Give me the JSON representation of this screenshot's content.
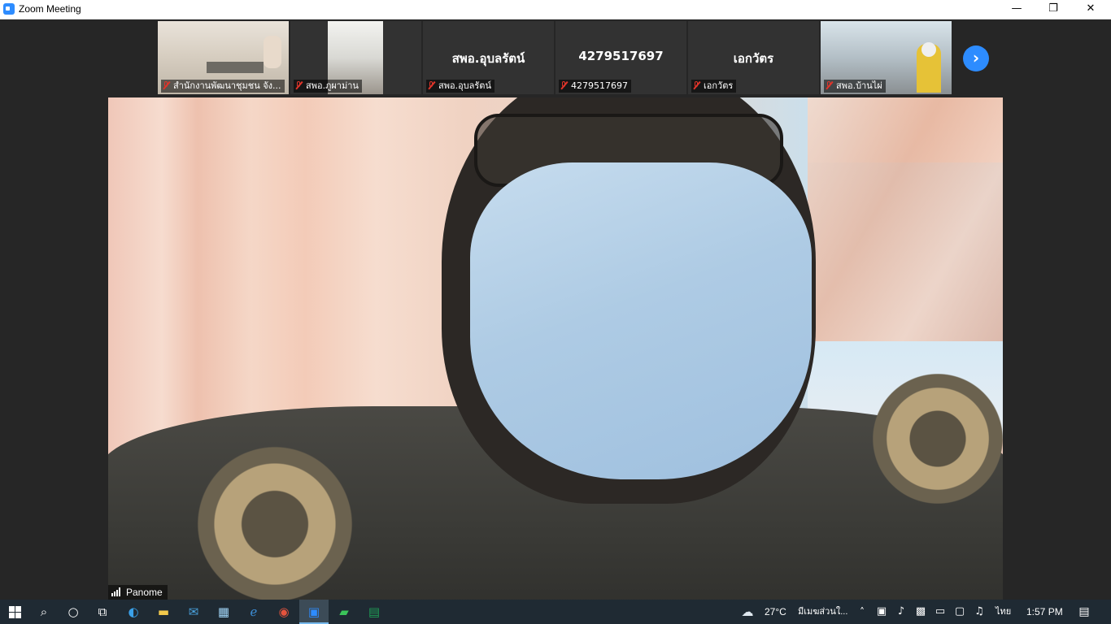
{
  "window": {
    "title": "Zoom Meeting",
    "minimize_glyph": "—",
    "maximize_glyph": "❐",
    "close_glyph": "✕"
  },
  "gallery": {
    "tiles": [
      {
        "label": "สำนักงานพัฒนาชุมชน จัง...",
        "muted": true,
        "has_video": true
      },
      {
        "label": "สพอ.ภูผาม่าน",
        "muted": true,
        "has_video": true
      },
      {
        "display_name": "สพอ.อุบลรัตน์",
        "label": "สพอ.อุบลรัตน์",
        "muted": true,
        "has_video": false
      },
      {
        "display_name": "4279517697",
        "label": "4279517697",
        "muted": true,
        "has_video": false
      },
      {
        "display_name": "เอกวัตร",
        "label": "เอกวัตร",
        "muted": true,
        "has_video": false
      },
      {
        "label": "สพอ.บ้านไผ่",
        "muted": true,
        "has_video": true
      }
    ],
    "next_glyph": "›"
  },
  "speaker": {
    "name": "Panome"
  },
  "taskbar": {
    "weather_temp": "27°C",
    "weather_text": "มีเมฆส่วนใ...",
    "language": "ไทย",
    "time": "1:57 PM"
  },
  "colors": {
    "accent": "#2d8cff",
    "muted_red": "#e0342a",
    "background": "#262626"
  }
}
